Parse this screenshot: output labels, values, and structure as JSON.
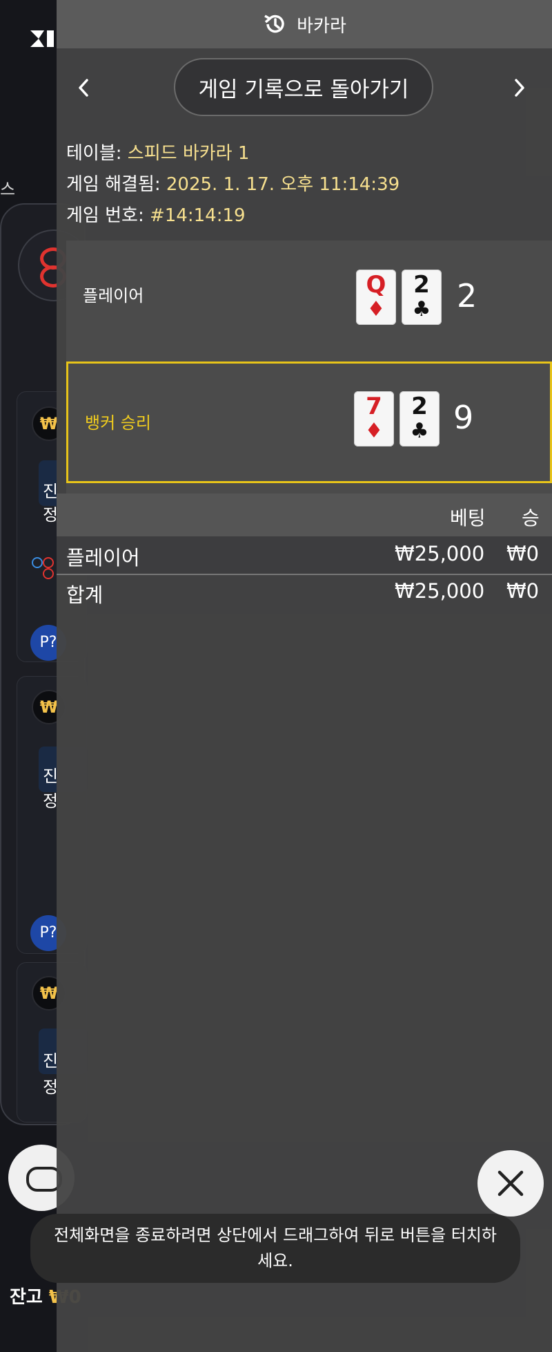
{
  "header": {
    "title": "바카라",
    "history_icon": "history-icon"
  },
  "nav": {
    "back_label": "게임 기록으로 돌아가기",
    "prev_icon": "chevron-left-icon",
    "next_icon": "chevron-right-icon"
  },
  "info": {
    "table_label": "테이블: ",
    "table_value": "스피드 바카라 1",
    "resolved_label": "게임 해결됨: ",
    "resolved_value": "2025. 1. 17. 오후 11:14:39",
    "game_no_label": "게임 번호: ",
    "game_no_value": "#14:14:19"
  },
  "result": {
    "player": {
      "label": "플레이어",
      "cards": [
        {
          "rank": "Q",
          "suit": "♦"
        },
        {
          "rank": "2",
          "suit": "♣"
        }
      ],
      "score": "2"
    },
    "banker": {
      "label": "뱅커 승리",
      "cards": [
        {
          "rank": "7",
          "suit": "♦"
        },
        {
          "rank": "2",
          "suit": "♣"
        }
      ],
      "score": "9"
    }
  },
  "bets": {
    "headers": {
      "bet": "베팅",
      "win": "승"
    },
    "rows": [
      {
        "name": "플레이어",
        "bet": "₩25,000",
        "win": "₩0"
      }
    ],
    "total": {
      "name": "합계",
      "bet": "₩25,000",
      "win": "₩0"
    }
  },
  "toast": "전체화면을 종료하려면 상단에서 드래그하여 뒤로 버튼을 터치하세요.",
  "background": {
    "side_text": "스",
    "chips": [
      "₩",
      "₩",
      "₩"
    ],
    "blue_texts": [
      [
        "진",
        "정"
      ],
      [
        "진",
        "정"
      ],
      [
        "진",
        "정"
      ]
    ],
    "p_badges": [
      "P?",
      "P?"
    ],
    "balance_label": "잔고 ",
    "balance_value": "₩0"
  },
  "colors": {
    "accent_yellow": "#e8c419",
    "info_value": "#f7e08f",
    "red_suit": "#d61f25",
    "overlay": "#444444"
  }
}
